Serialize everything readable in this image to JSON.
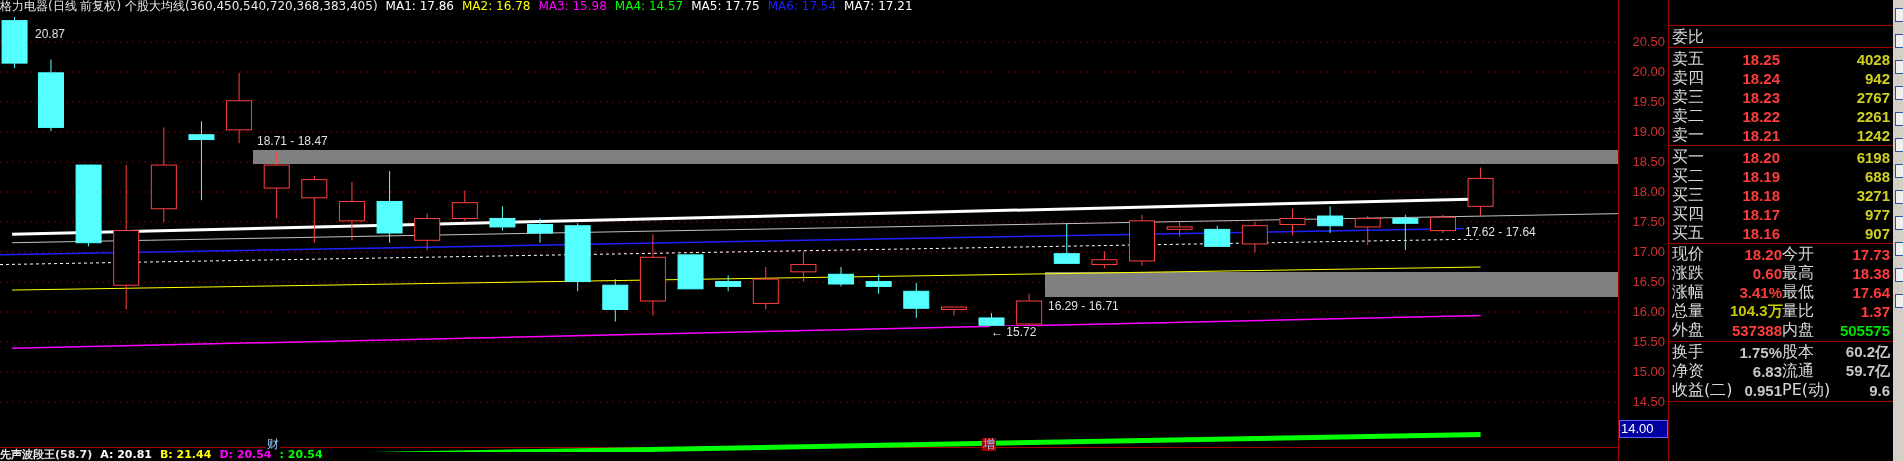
{
  "header": {
    "title": "格力电器(日线 前复权) 个股大均线(360,450,540,720,368,383,405)",
    "ma": [
      {
        "label": "MA1: 17.86",
        "color": "#ffffff"
      },
      {
        "label": "MA2: 16.78",
        "color": "#ffff00"
      },
      {
        "label": "MA3: 15.98",
        "color": "#ff00ff"
      },
      {
        "label": "MA4: 14.57",
        "color": "#00ff00"
      },
      {
        "label": "MA5: 17.75",
        "color": "#ffffff"
      },
      {
        "label": "MA6: 17.54",
        "color": "#2020ff"
      },
      {
        "label": "MA7: 17.21",
        "color": "#ffffff"
      }
    ]
  },
  "chart": {
    "high_label": "20.87",
    "zones": [
      {
        "label": "18.71 - 18.47"
      },
      {
        "label": "16.29 - 16.71"
      }
    ],
    "notes": [
      {
        "kind": "range",
        "text": "17.62 - 17.64"
      },
      {
        "kind": "low",
        "text": "← 15.72"
      }
    ],
    "markers": [
      {
        "text": "财",
        "color": "#000000"
      },
      {
        "text": "增",
        "color": "#a00000"
      }
    ]
  },
  "axis": {
    "ticks": [
      "20.50",
      "20.00",
      "19.50",
      "19.00",
      "18.50",
      "18.00",
      "17.50",
      "17.00",
      "16.50",
      "16.00",
      "15.50",
      "15.00",
      "14.50"
    ],
    "cursor": "14.00"
  },
  "indicator": {
    "title": "先声波段王(58.7)",
    "values": [
      {
        "text": "A: 20.81",
        "color": "#ffffff"
      },
      {
        "text": "B: 21.44",
        "color": "#ffff00"
      },
      {
        "text": "D: 20.54",
        "color": "#ff00ff"
      },
      {
        "text": ": 20.54",
        "color": "#00ff00"
      }
    ]
  },
  "quote": {
    "ratio_label": "委比",
    "asks": [
      {
        "label": "卖五",
        "price": "18.25",
        "volume": "4028"
      },
      {
        "label": "卖四",
        "price": "18.24",
        "volume": "942"
      },
      {
        "label": "卖三",
        "price": "18.23",
        "volume": "2767"
      },
      {
        "label": "卖二",
        "price": "18.22",
        "volume": "2261"
      },
      {
        "label": "卖一",
        "price": "18.21",
        "volume": "1242"
      }
    ],
    "bids": [
      {
        "label": "买一",
        "price": "18.20",
        "volume": "6198"
      },
      {
        "label": "买二",
        "price": "18.19",
        "volume": "688"
      },
      {
        "label": "买三",
        "price": "18.18",
        "volume": "3271"
      },
      {
        "label": "买四",
        "price": "18.17",
        "volume": "977"
      },
      {
        "label": "买五",
        "price": "18.16",
        "volume": "907"
      }
    ],
    "stats": [
      {
        "label": "现价",
        "value": "18.20",
        "color": "#ff3c3c"
      },
      {
        "label": "今开",
        "value": "17.73",
        "color": "#ff3c3c"
      },
      {
        "label": "涨跌",
        "value": "0.60",
        "color": "#ff3c3c"
      },
      {
        "label": "最高",
        "value": "18.38",
        "color": "#ff3c3c"
      },
      {
        "label": "涨幅",
        "value": "3.41%",
        "color": "#ff3c3c"
      },
      {
        "label": "最低",
        "value": "17.64",
        "color": "#ff3c3c"
      },
      {
        "label": "总量",
        "value": "104.3万",
        "color": "#c8c800"
      },
      {
        "label": "量比",
        "value": "1.37",
        "color": "#ff3c3c"
      },
      {
        "label": "外盘",
        "value": "537388",
        "color": "#ff3c3c"
      },
      {
        "label": "内盘",
        "value": "505575",
        "color": "#00e000"
      }
    ],
    "fundamentals": [
      {
        "label": "换手",
        "value": "1.75%"
      },
      {
        "label": "股本",
        "value": "60.2亿"
      },
      {
        "label": "净资",
        "value": "6.83"
      },
      {
        "label": "流通",
        "value": "59.7亿"
      },
      {
        "label": "收益(二)",
        "value": "0.951"
      },
      {
        "label": "PE(动)",
        "value": "9.6"
      }
    ]
  }
}
